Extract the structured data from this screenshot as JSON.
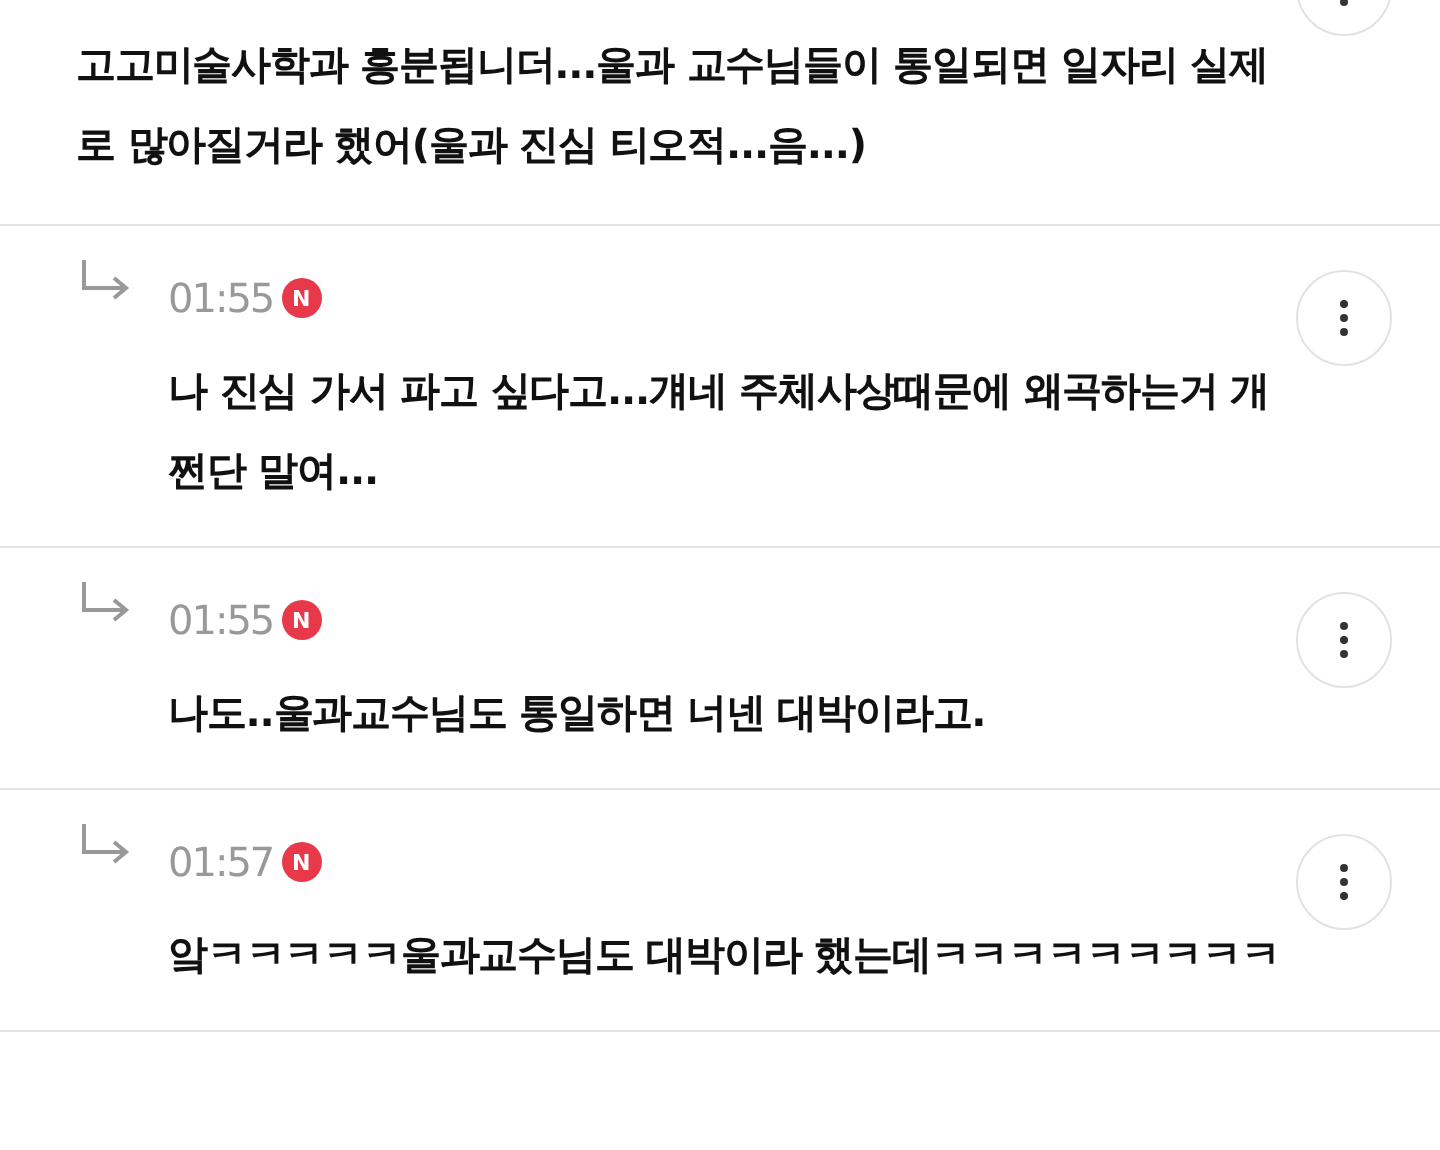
{
  "comment": {
    "text": "고고미술사학과 흥분됩니더...울과 교수님들이 통일되면 일자리 실제로 많아질거라 했어(울과 진심 티오적...음...)"
  },
  "replies": [
    {
      "time": "01:55",
      "badge": "N",
      "text": "나 진심 가서 파고 싶다고...걔네 주체사상때문에 왜곡하는거 개쩐단 말여..."
    },
    {
      "time": "01:55",
      "badge": "N",
      "text": "나도..울과교수님도 통일하면 너넨 대박이라고."
    },
    {
      "time": "01:57",
      "badge": "N",
      "text": "앜ㅋㅋㅋㅋㅋ울과교수님도 대박이라 했는데ㅋㅋㅋㅋㅋㅋㅋㅋㅋ"
    }
  ]
}
